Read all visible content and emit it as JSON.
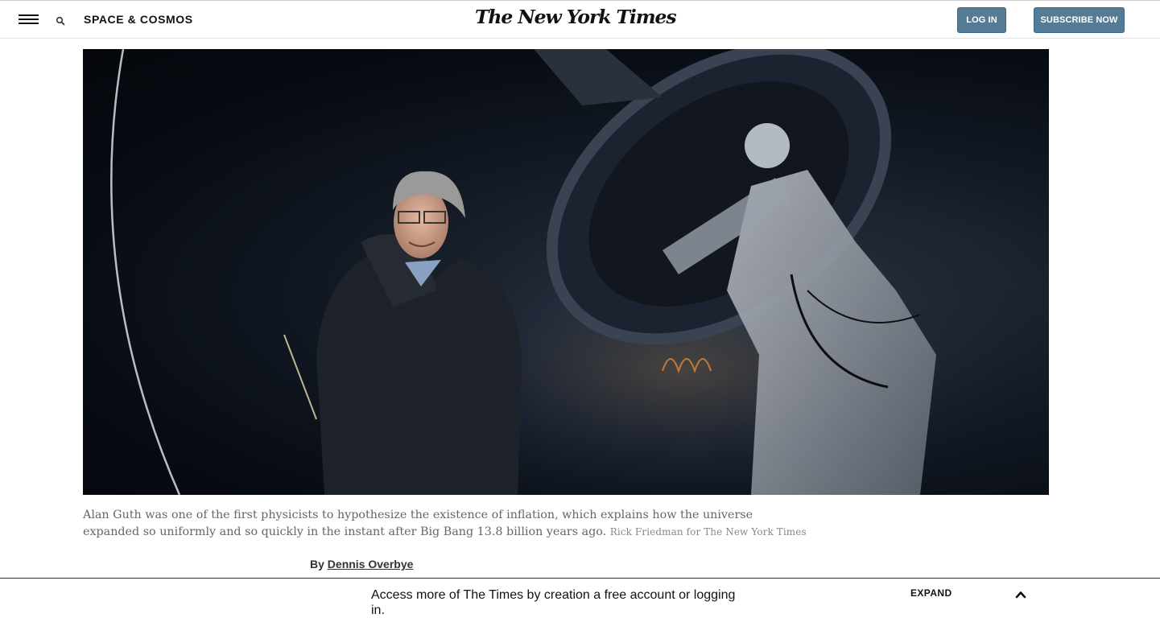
{
  "header": {
    "menu_icon": "hamburger-menu-icon",
    "search_icon": "search-icon",
    "section": "SPACE & COSMOS",
    "masthead": "The New York Times",
    "login_label": "LOG IN",
    "subscribe_label": "SUBSCRIBE NOW",
    "button_color": "#567b95"
  },
  "hero": {
    "image": "Portrait of a smiling man with glasses and grey hair in a dark jacket standing beside a large telescope at dusk"
  },
  "caption": {
    "text": "Alan Guth was one of the first physicists to hypothesize the existence of inflation, which explains how the universe expanded so uniformly and so quickly in the instant after Big Bang 13.8 billion years ago.",
    "credit": "Rick Friedman for The New York Times"
  },
  "byline": {
    "prefix": "By",
    "author": "Dennis Overbye"
  },
  "bottom_bar": {
    "message": "Access more of The Times by creation a free account or logging in.",
    "expand_label": "EXPAND",
    "chevron_icon": "chevron-up-icon"
  }
}
